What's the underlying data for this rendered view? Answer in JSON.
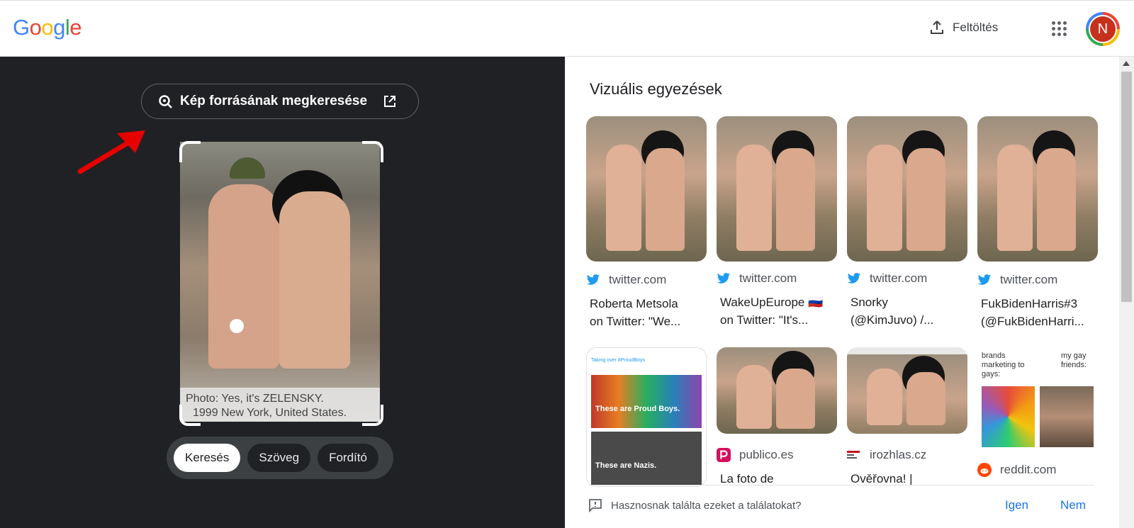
{
  "header": {
    "logo_letters": [
      "G",
      "o",
      "o",
      "g",
      "l",
      "e"
    ],
    "upload_label": "Feltöltés",
    "avatar_initial": "N"
  },
  "left": {
    "find_source_label": "Kép forrásának megkeresése",
    "caption_line1": "Photo: Yes, it's ZELENSKY.",
    "caption_line2": "1999 New York, United States.",
    "modes": [
      {
        "label": "Keresés",
        "active": true
      },
      {
        "label": "Szöveg",
        "active": false
      },
      {
        "label": "Fordító",
        "active": false
      }
    ]
  },
  "right": {
    "title": "Vizuális egyezések",
    "cards": [
      {
        "site": "twitter.com",
        "line1": "Roberta Metsola",
        "line2": "on Twitter: \"We..."
      },
      {
        "site": "twitter.com",
        "line1": "WakeUpEurope 🇷🇺",
        "line2": "on Twitter: \"It's..."
      },
      {
        "site": "twitter.com",
        "line1": "Snorky",
        "line2": "(@KimJuvo) /..."
      },
      {
        "site": "twitter.com",
        "line1": "FukBidenHarris#3",
        "line2": "(@FukBidenHarri..."
      },
      {
        "site": "",
        "line1": "",
        "line2": "",
        "tweet_top": "Taking over #ProudBoys",
        "tweet_mid": "These are Proud Boys.",
        "tweet_bot": "These are Nazis."
      },
      {
        "site": "publico.es",
        "line1": "La foto de",
        "line2": ""
      },
      {
        "site": "irozhlas.cz",
        "line1": "Ověřovna! |",
        "line2": ""
      },
      {
        "site": "reddit.com",
        "line1": "",
        "line2": "",
        "meme_left": "brands marketing to gays:",
        "meme_right": "my gay friends:"
      }
    ],
    "feedback_question": "Hasznosnak találta ezeket a találatokat?",
    "feedback_yes": "Igen",
    "feedback_no": "Nem"
  },
  "colors": {
    "twitter": "#1d9bf0",
    "publico": "#d5105c",
    "reddit": "#ff4500",
    "link": "#1a73e8",
    "dark_bg": "#202124"
  }
}
